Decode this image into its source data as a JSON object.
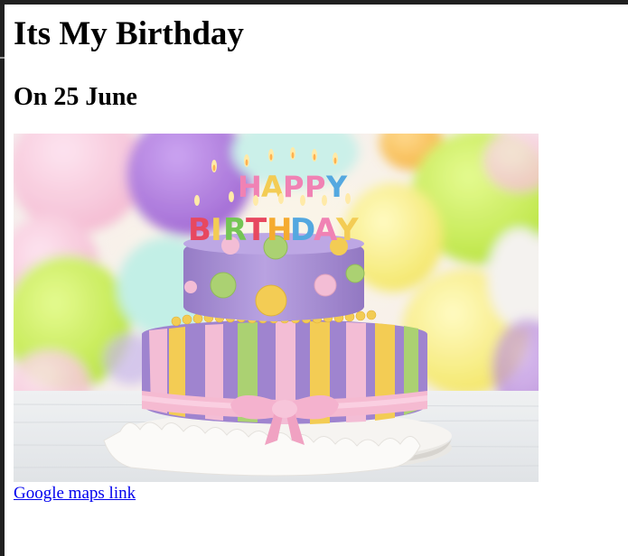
{
  "page": {
    "heading": "Its My Birthday",
    "subheading": "On 25 June"
  },
  "image": {
    "name": "birthday-cake-photo",
    "toppers_top_word": "HAPPY",
    "toppers_bottom_word": "BIRTHDAY",
    "colors": {
      "cake_top_tier": "#a98fd2",
      "cake_bottom_purple": "#9c7fcf",
      "stripe_yellow": "#f3c94a",
      "stripe_green": "#a6cf6a",
      "stripe_pink": "#f3b9d3",
      "ribbon_pink": "#f6bad2",
      "balloon_green": "#c6ee4a",
      "balloon_purple": "#a86fd8",
      "balloon_yellow": "#f6e86a"
    }
  },
  "link": {
    "label": "Google maps link"
  }
}
